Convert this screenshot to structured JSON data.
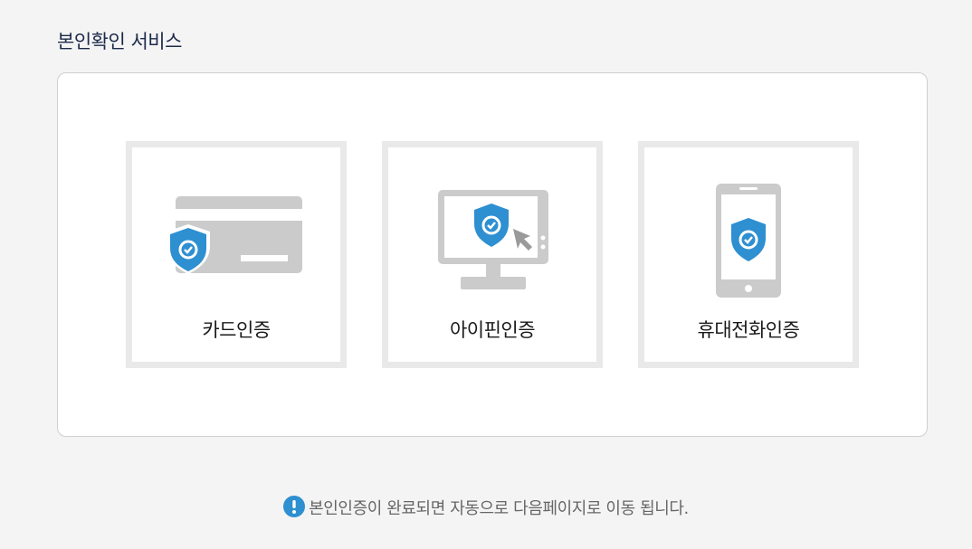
{
  "page": {
    "title": "본인확인 서비스"
  },
  "options": [
    {
      "label": "카드인증",
      "icon": "card-shield-icon"
    },
    {
      "label": "아이핀인증",
      "icon": "monitor-shield-icon"
    },
    {
      "label": "휴대전화인증",
      "icon": "phone-shield-icon"
    }
  ],
  "notice": {
    "text": "본인인증이 완료되면 자동으로 다음페이지로 이동 됩니다.",
    "icon": "info-icon"
  },
  "colors": {
    "accent": "#2e8fd1",
    "icon_gray": "#cbcbcb",
    "title": "#1c2a4a"
  }
}
